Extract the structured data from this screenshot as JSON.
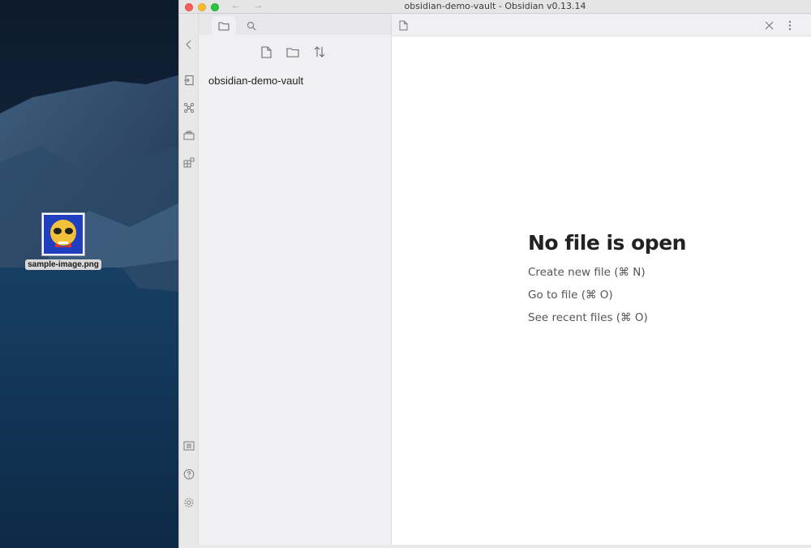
{
  "desktop": {
    "file_icon_label": "sample-image.png"
  },
  "window": {
    "title": "obsidian-demo-vault - Obsidian v0.13.14",
    "nav_back": "←",
    "nav_forward": "→"
  },
  "ribbon": {
    "icons": [
      "open-quick-switcher-icon",
      "graph-view-icon",
      "open-card-icon",
      "templates-icon",
      "vault-switch-icon",
      "help-icon",
      "settings-icon"
    ]
  },
  "explorer": {
    "tabs": [
      "file-explorer-icon",
      "search-icon"
    ],
    "actions": [
      "new-note-icon",
      "new-folder-icon",
      "sort-icon"
    ],
    "vault_name": "obsidian-demo-vault"
  },
  "main": {
    "empty_title": "No file is open",
    "actions": [
      "Create new file (⌘ N)",
      "Go to file (⌘ O)",
      "See recent files (⌘ O)"
    ]
  },
  "colors": {
    "accent_red": "#fe5f57",
    "accent_yellow": "#febc2e",
    "accent_green": "#28c840"
  }
}
